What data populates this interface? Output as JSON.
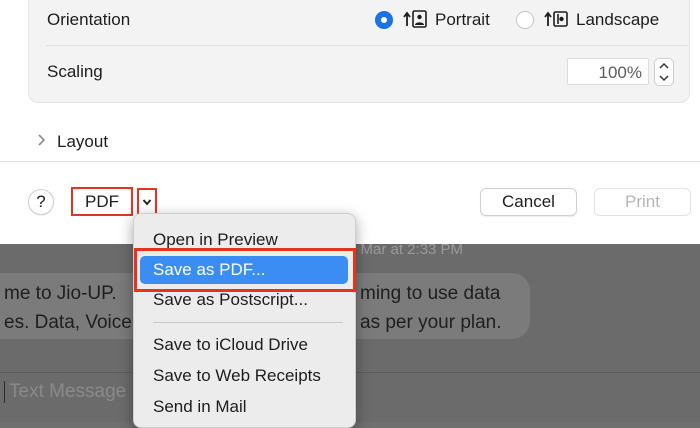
{
  "colors": {
    "accent": "#1a73e8",
    "menu_highlight": "#3a8ef3",
    "annotation_red": "#e8321e"
  },
  "print_dialog": {
    "orientation": {
      "label": "Orientation",
      "options": [
        {
          "label": "Portrait",
          "selected": true,
          "icon": "portrait-orientation-icon"
        },
        {
          "label": "Landscape",
          "selected": false,
          "icon": "landscape-orientation-icon"
        }
      ]
    },
    "scaling": {
      "label": "Scaling",
      "value": "100%"
    },
    "layout": {
      "label": "Layout",
      "icon": "chevron-right-icon"
    },
    "buttons": {
      "help": "?",
      "pdf": "PDF",
      "cancel": "Cancel",
      "print": "Print"
    }
  },
  "pdf_menu": {
    "items": [
      "Open in Preview",
      "Save as PDF...",
      "Save as Postscript...",
      "Save to iCloud Drive",
      "Save to Web Receipts",
      "Send in Mail"
    ],
    "highlighted": "Save as PDF..."
  },
  "background_messages": {
    "timestamp": "1 Mar at 2:33 PM",
    "message_line1": "me to Jio-UP.",
    "message_line1_right": "ming to use data",
    "message_line2": "es. Data, Voice",
    "message_line2_right": "as per your plan.",
    "input_placeholder": "Text Message"
  }
}
